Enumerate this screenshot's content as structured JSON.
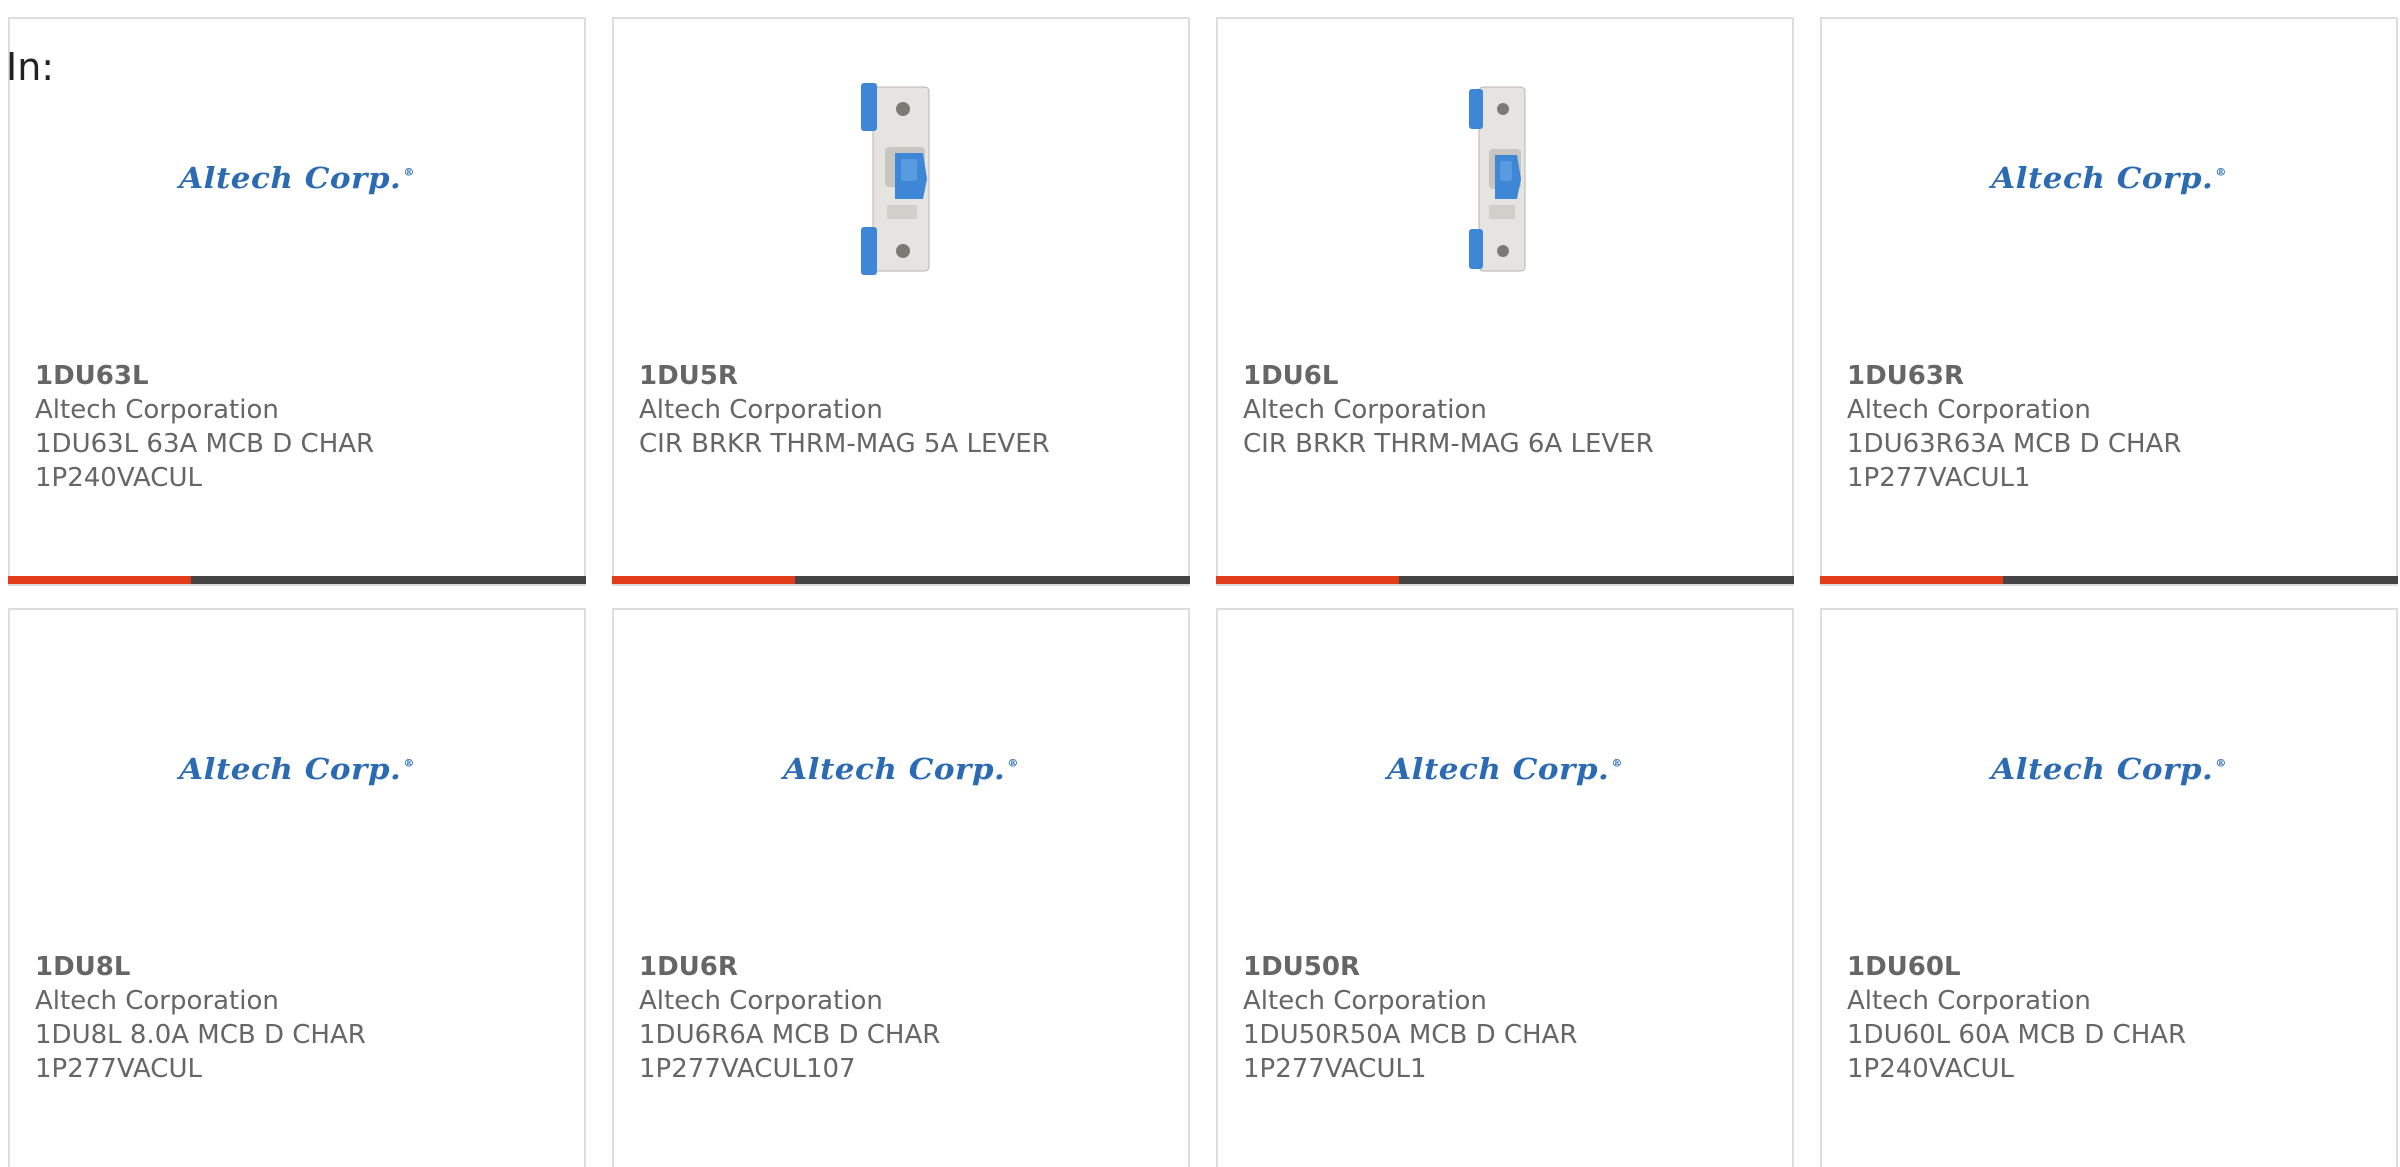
{
  "header": {
    "in_label": "In:"
  },
  "logo": {
    "text": "Altech Corp.",
    "reg": "®",
    "color": "#2b6bb3"
  },
  "colors": {
    "accent_bar": "#e23d1a",
    "dark_bar": "#444444",
    "text": "#666666",
    "breaker_blue": "#3e86d6"
  },
  "products": [
    {
      "part": "1DU63L",
      "manufacturer": "Altech Corporation",
      "desc_line1": "1DU63L 63A MCB D CHAR",
      "desc_line2": "1P240VACUL",
      "image": "altech-logo"
    },
    {
      "part": "1DU5R",
      "manufacturer": "Altech Corporation",
      "desc_line1": "CIR BRKR THRM-MAG 5A LEVER",
      "desc_line2": "",
      "image": "circuit-breaker-photo"
    },
    {
      "part": "1DU6L",
      "manufacturer": "Altech Corporation",
      "desc_line1": "CIR BRKR THRM-MAG 6A LEVER",
      "desc_line2": "",
      "image": "circuit-breaker-photo"
    },
    {
      "part": "1DU63R",
      "manufacturer": "Altech Corporation",
      "desc_line1": "1DU63R63A MCB D CHAR",
      "desc_line2": "1P277VACUL1",
      "image": "altech-logo"
    },
    {
      "part": "1DU8L",
      "manufacturer": "Altech Corporation",
      "desc_line1": "1DU8L 8.0A MCB D CHAR",
      "desc_line2": "1P277VACUL",
      "image": "altech-logo"
    },
    {
      "part": "1DU6R",
      "manufacturer": "Altech Corporation",
      "desc_line1": "1DU6R6A MCB D CHAR",
      "desc_line2": "1P277VACUL107",
      "image": "altech-logo"
    },
    {
      "part": "1DU50R",
      "manufacturer": "Altech Corporation",
      "desc_line1": "1DU50R50A MCB D CHAR",
      "desc_line2": "1P277VACUL1",
      "image": "altech-logo"
    },
    {
      "part": "1DU60L",
      "manufacturer": "Altech Corporation",
      "desc_line1": "1DU60L 60A MCB D CHAR",
      "desc_line2": "1P240VACUL",
      "image": "altech-logo"
    }
  ]
}
